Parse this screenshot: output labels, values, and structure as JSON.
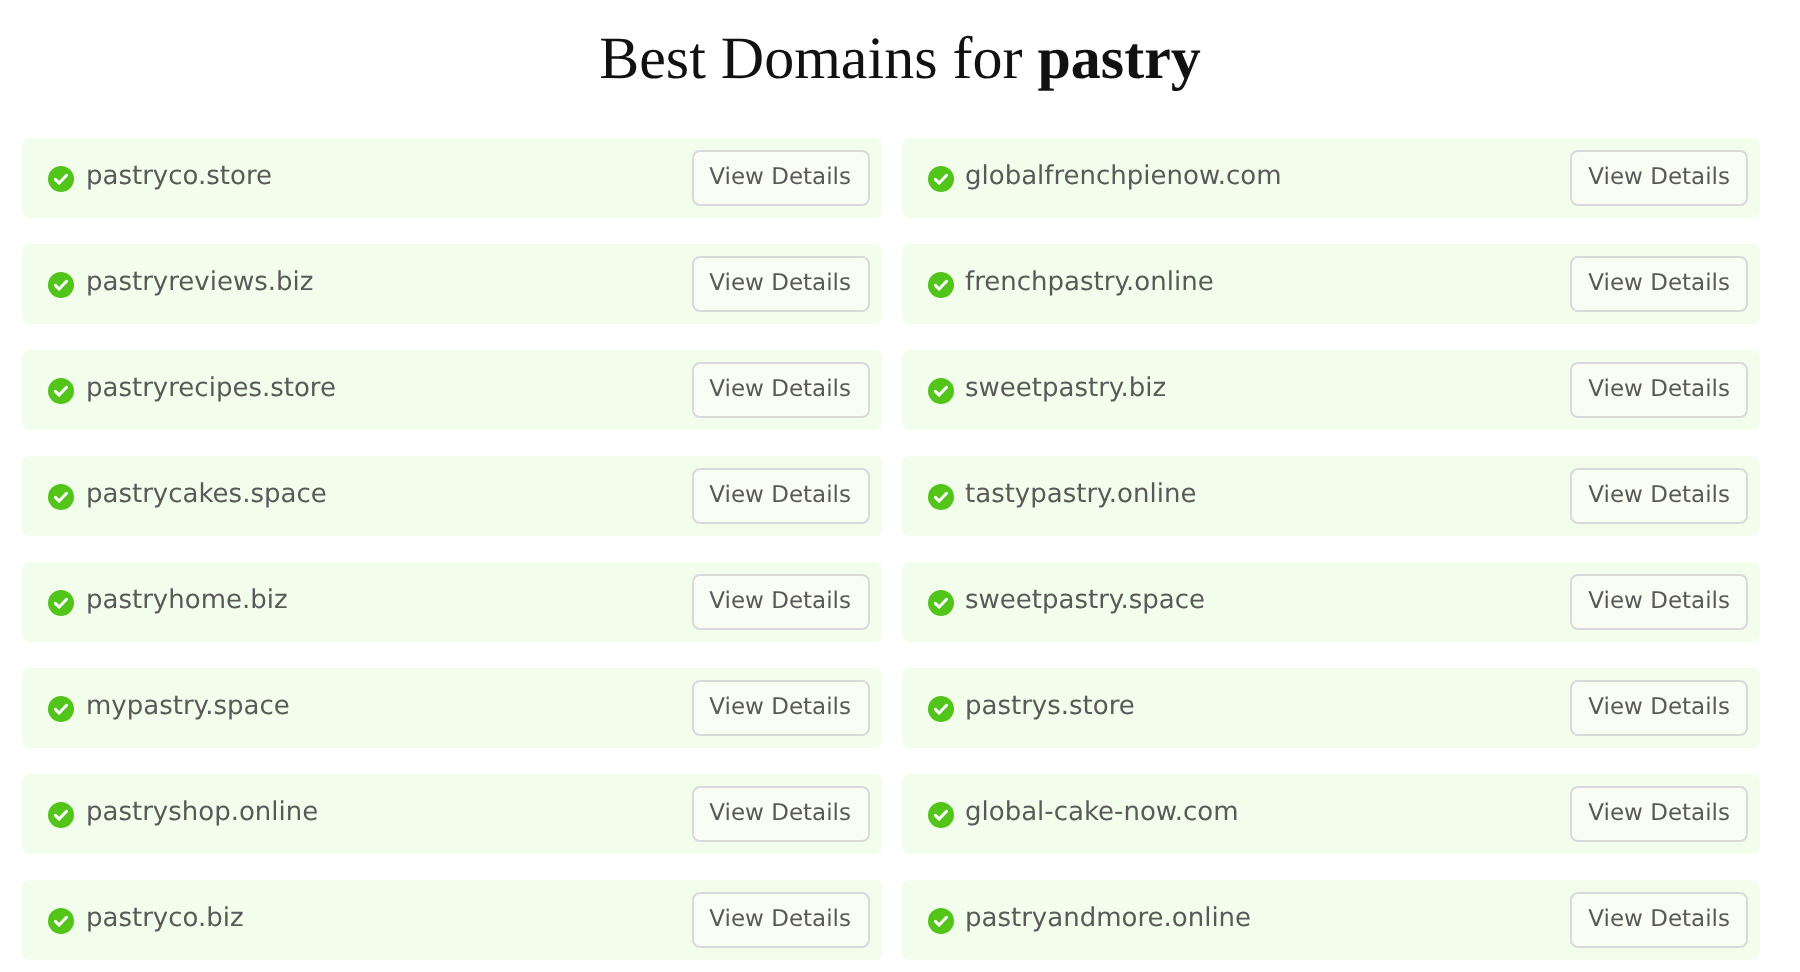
{
  "title": "Best Domains for **pastry**",
  "domains": [
    {
      "name": "pastryco.store",
      "available": true,
      "button": "View Details"
    },
    {
      "name": "globalfrenchpienow.com",
      "available": true,
      "button": "View Details"
    },
    {
      "name": "pastryreviews.biz",
      "available": true,
      "button": "View Details"
    },
    {
      "name": "frenchpastry.online",
      "available": true,
      "button": "View Details"
    },
    {
      "name": "pastryrecipes.store",
      "available": true,
      "button": "View Details"
    },
    {
      "name": "sweetpastry.biz",
      "available": true,
      "button": "View Details"
    },
    {
      "name": "pastrycakes.space",
      "available": true,
      "button": "View Details"
    },
    {
      "name": "tastypastry.online",
      "available": true,
      "button": "View Details"
    },
    {
      "name": "pastryhome.biz",
      "available": true,
      "button": "View Details"
    },
    {
      "name": "sweetpastry.space",
      "available": true,
      "button": "View Details"
    },
    {
      "name": "mypastry.space",
      "available": true,
      "button": "View Details"
    },
    {
      "name": "pastrys.store",
      "available": true,
      "button": "View Details"
    },
    {
      "name": "pastryshop.online",
      "available": true,
      "button": "View Details"
    },
    {
      "name": "global-cake-now.com",
      "available": true,
      "button": "View Details"
    },
    {
      "name": "pastryco.biz",
      "available": true,
      "button": "View Details"
    },
    {
      "name": "pastryandmore.online",
      "available": true,
      "button": "View Details"
    }
  ]
}
